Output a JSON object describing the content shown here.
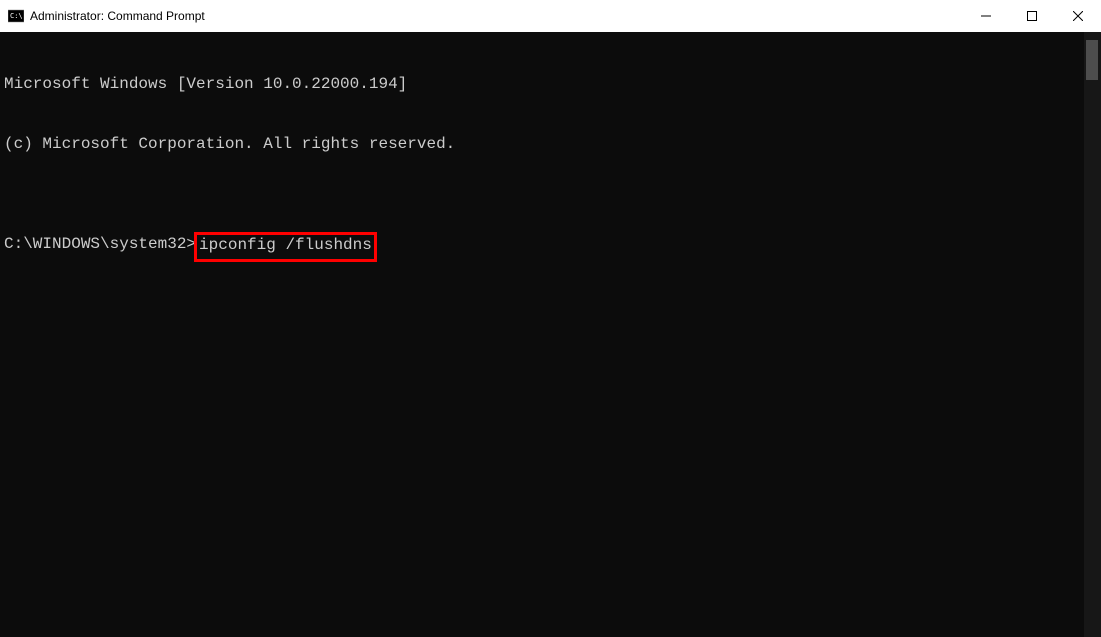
{
  "window": {
    "title": "Administrator: Command Prompt"
  },
  "terminal": {
    "line1": "Microsoft Windows [Version 10.0.22000.194]",
    "line2": "(c) Microsoft Corporation. All rights reserved.",
    "blank": "",
    "prompt": "C:\\WINDOWS\\system32>",
    "command": "ipconfig /flushdns"
  },
  "highlight": {
    "color": "#ff0000"
  }
}
